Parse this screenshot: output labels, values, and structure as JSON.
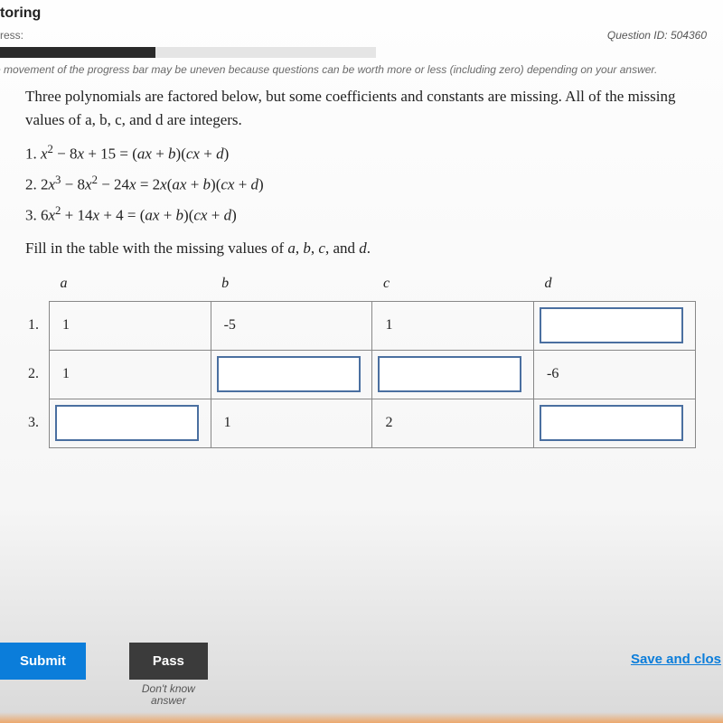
{
  "header": {
    "title_partial": "toring",
    "progress_label_partial": "ress:",
    "question_id_label": "Question ID: 504360",
    "note_partial": "e movement of the progress bar may be uneven because questions can be worth more or less (including zero) depending on your answer."
  },
  "question": {
    "prompt": "Three polynomials are factored below, but some coefficients and constants are missing. All of the missing values of a, b, c, and d are integers.",
    "eq1": "1. x² − 8x + 15 = (ax + b)(cx + d)",
    "eq2": "2. 2x³ − 8x² − 24x = 2x(ax + b)(cx + d)",
    "eq3": "3. 6x² + 14x + 4 = (ax + b)(cx + d)",
    "fill_line": "Fill in the table with the missing values of a, b, c, and d."
  },
  "table": {
    "cols": {
      "a": "a",
      "b": "b",
      "c": "c",
      "d": "d"
    },
    "rows": [
      {
        "num": "1.",
        "a": "1",
        "b": "-5",
        "c": "1",
        "d": ""
      },
      {
        "num": "2.",
        "a": "1",
        "b": "",
        "c": "",
        "d": "-6"
      },
      {
        "num": "3.",
        "a": "",
        "b": "1",
        "c": "2",
        "d": ""
      }
    ]
  },
  "footer": {
    "submit": "Submit",
    "pass": "Pass",
    "dont_know": "Don't know",
    "answer": "answer",
    "save_close": "Save and clos"
  }
}
